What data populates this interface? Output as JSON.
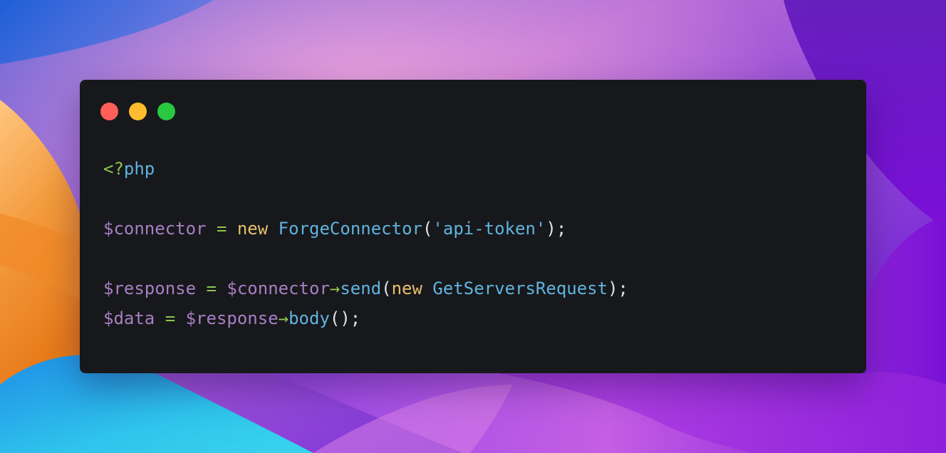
{
  "colors": {
    "window_bg": "#17181b",
    "traffic_red": "#ff5f57",
    "traffic_yellow": "#febc2e",
    "traffic_green": "#28c840",
    "variable": "#a77fc4",
    "keyword": "#e5c06b",
    "class": "#5fb4e0",
    "string": "#5fb4e0",
    "function": "#5fb4e0",
    "operator": "#8ec54f",
    "punctuation": "#e2e2e2",
    "tag": "#8ec54f"
  },
  "window": {
    "controls": {
      "close_icon": "red-circle",
      "minimize_icon": "yellow-circle",
      "maximize_icon": "green-circle"
    }
  },
  "code": {
    "language": "php",
    "lines": [
      [
        {
          "text": "<?",
          "kind": "tag"
        },
        {
          "text": "php",
          "kind": "class"
        }
      ],
      [],
      [
        {
          "text": "$connector",
          "kind": "variable"
        },
        {
          "text": " ",
          "kind": "punctuation"
        },
        {
          "text": "=",
          "kind": "operator"
        },
        {
          "text": " ",
          "kind": "punctuation"
        },
        {
          "text": "new",
          "kind": "keyword"
        },
        {
          "text": " ",
          "kind": "punctuation"
        },
        {
          "text": "ForgeConnector",
          "kind": "class"
        },
        {
          "text": "(",
          "kind": "punctuation"
        },
        {
          "text": "'api-token'",
          "kind": "string"
        },
        {
          "text": ");",
          "kind": "punctuation"
        }
      ],
      [],
      [
        {
          "text": "$response",
          "kind": "variable"
        },
        {
          "text": " ",
          "kind": "punctuation"
        },
        {
          "text": "=",
          "kind": "operator"
        },
        {
          "text": " ",
          "kind": "punctuation"
        },
        {
          "text": "$connector",
          "kind": "variable"
        },
        {
          "text": "→",
          "kind": "operator"
        },
        {
          "text": "send",
          "kind": "function"
        },
        {
          "text": "(",
          "kind": "punctuation"
        },
        {
          "text": "new",
          "kind": "keyword"
        },
        {
          "text": " ",
          "kind": "punctuation"
        },
        {
          "text": "GetServersRequest",
          "kind": "class"
        },
        {
          "text": ");",
          "kind": "punctuation"
        }
      ],
      [
        {
          "text": "$data",
          "kind": "variable"
        },
        {
          "text": " ",
          "kind": "punctuation"
        },
        {
          "text": "=",
          "kind": "operator"
        },
        {
          "text": " ",
          "kind": "punctuation"
        },
        {
          "text": "$response",
          "kind": "variable"
        },
        {
          "text": "→",
          "kind": "operator"
        },
        {
          "text": "body",
          "kind": "function"
        },
        {
          "text": "();",
          "kind": "punctuation"
        }
      ]
    ]
  }
}
